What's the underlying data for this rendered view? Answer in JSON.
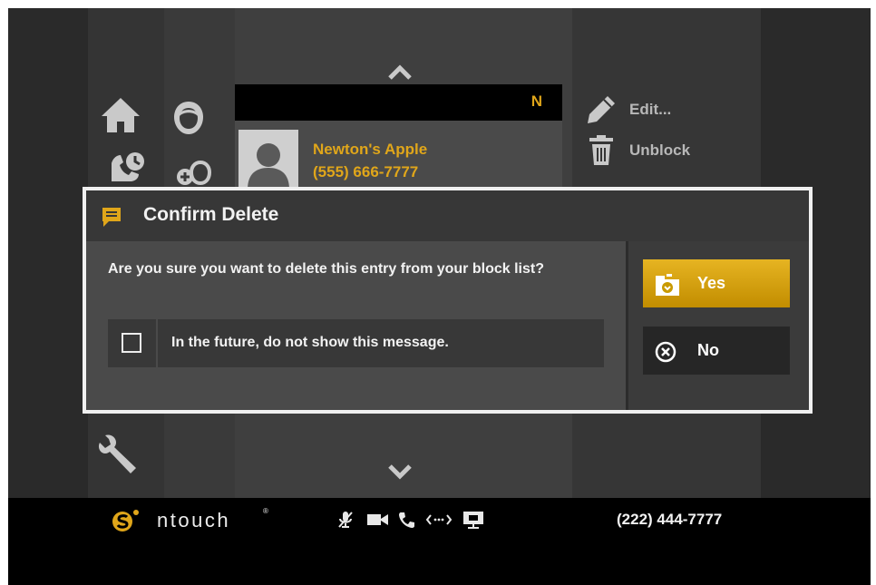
{
  "contacts": {
    "letter": "N",
    "entry": {
      "name": "Newton's Apple",
      "phone": "(555) 666-7777"
    }
  },
  "actions": {
    "edit": "Edit...",
    "unblock": "Unblock"
  },
  "dialog": {
    "title": "Confirm Delete",
    "message": "Are you sure you want to delete this entry from your block list?",
    "checkbox_label": "In the future, do not show this message.",
    "checkbox_checked": false,
    "yes_label": "Yes",
    "no_label": "No"
  },
  "footer": {
    "brand": "ntouch",
    "brand_mark": "®",
    "phone": "(222) 444-7777"
  },
  "icons": {
    "nav": [
      "home-icon",
      "call-history-icon",
      "contacts-icon",
      "add-contact-icon",
      "settings-wrench-icon"
    ],
    "status": [
      "mic-muted-icon",
      "video-icon",
      "phone-icon",
      "connection-icon",
      "screen-share-icon"
    ]
  },
  "colors": {
    "accent": "#e0a61a",
    "yes_button": "#d9a514",
    "dialog_border": "#f0f0f0",
    "footer_bg": "#000000"
  }
}
